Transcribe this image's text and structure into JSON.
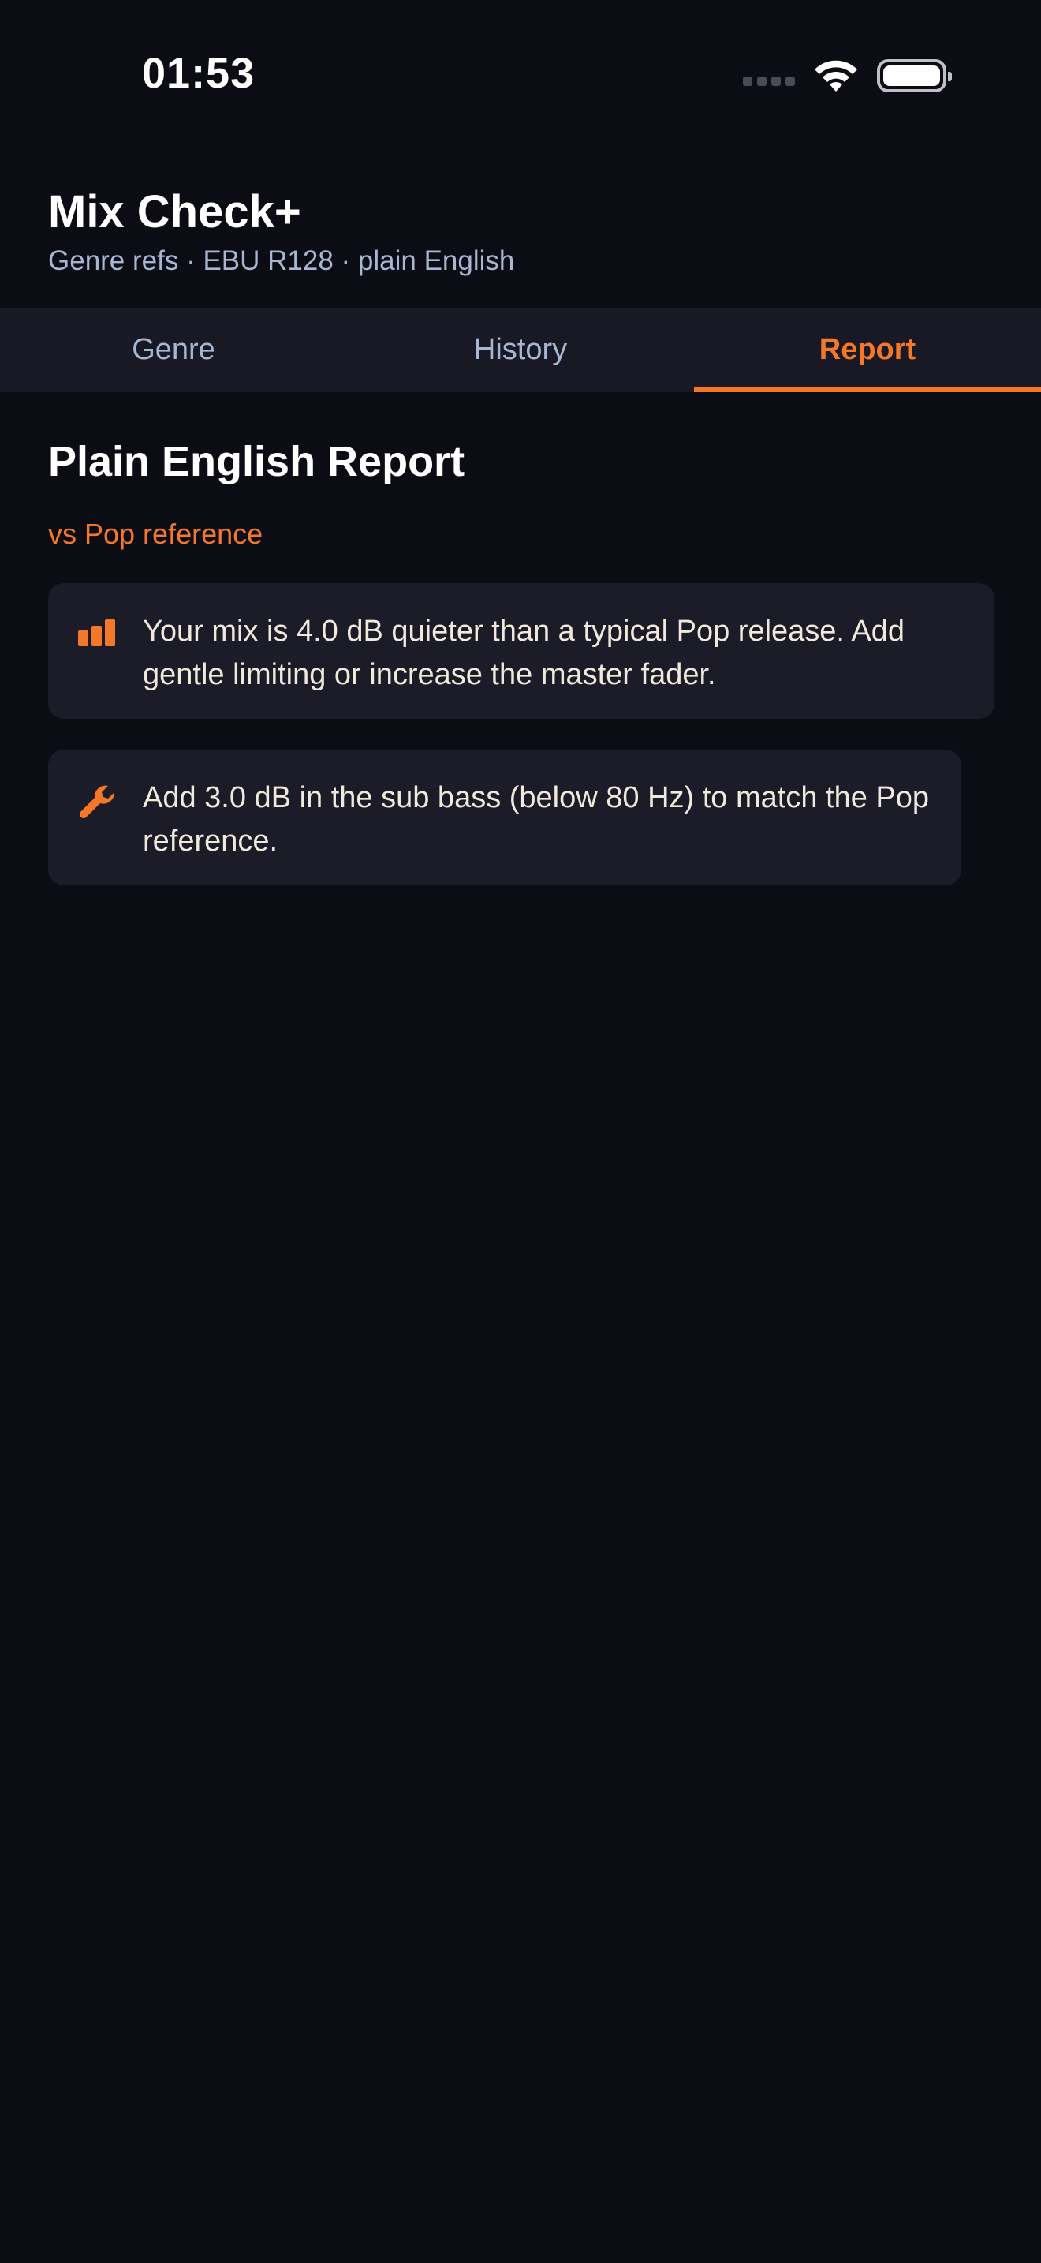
{
  "status_bar": {
    "time": "01:53",
    "icons": [
      "cellular-signal-icon",
      "wifi-icon",
      "battery-icon"
    ]
  },
  "header": {
    "title": "Mix Check+",
    "subtitle": "Genre refs · EBU R128 · plain English"
  },
  "tabs": [
    {
      "label": "Genre",
      "active": false
    },
    {
      "label": "History",
      "active": false
    },
    {
      "label": "Report",
      "active": true
    }
  ],
  "report": {
    "title": "Plain English Report",
    "reference": "vs Pop reference",
    "items": [
      {
        "icon": "bar-chart-icon",
        "text": "Your mix is 4.0 dB quieter than a typical Pop release. Add gentle limiting or increase the master fader."
      },
      {
        "icon": "wrench-icon",
        "text": "Add 3.0 dB in the sub bass (below 80 Hz) to match the Pop reference."
      }
    ]
  },
  "colors": {
    "background": "#0b0c14",
    "surface": "#1b1c28",
    "accent": "#f5782a",
    "muted_text": "#a9b6d3",
    "body_text": "#f1e9dc"
  }
}
